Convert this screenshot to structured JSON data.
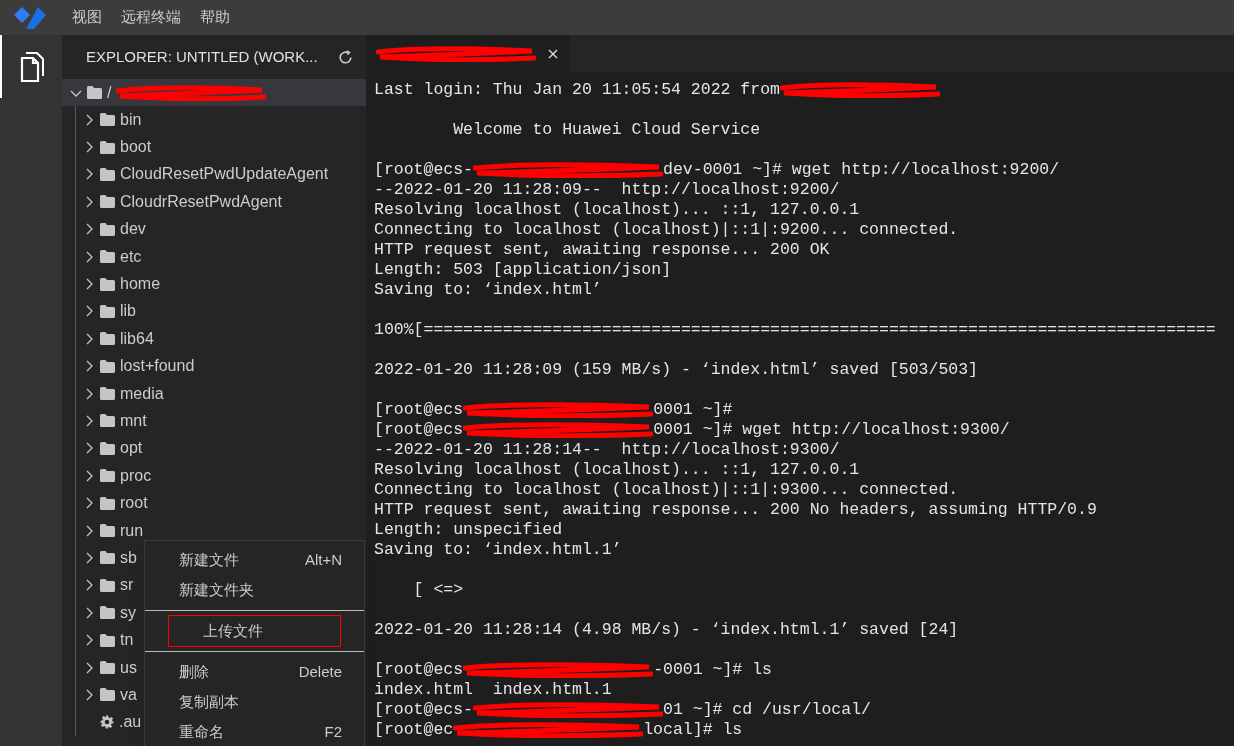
{
  "menu_bar": [
    "视图",
    "远程终端",
    "帮助"
  ],
  "explorer": {
    "title": "EXPLORER: UNTITLED (WORK...",
    "root": {
      "name": "/",
      "expanded": true,
      "selected": true,
      "redacted": true
    },
    "items": [
      {
        "name": "bin",
        "kind": "folder"
      },
      {
        "name": "boot",
        "kind": "folder"
      },
      {
        "name": "CloudResetPwdUpdateAgent",
        "kind": "folder"
      },
      {
        "name": "CloudrResetPwdAgent",
        "kind": "folder"
      },
      {
        "name": "dev",
        "kind": "folder"
      },
      {
        "name": "etc",
        "kind": "folder"
      },
      {
        "name": "home",
        "kind": "folder"
      },
      {
        "name": "lib",
        "kind": "folder"
      },
      {
        "name": "lib64",
        "kind": "folder"
      },
      {
        "name": "lost+found",
        "kind": "folder"
      },
      {
        "name": "media",
        "kind": "folder"
      },
      {
        "name": "mnt",
        "kind": "folder"
      },
      {
        "name": "opt",
        "kind": "folder"
      },
      {
        "name": "proc",
        "kind": "folder"
      },
      {
        "name": "root",
        "kind": "folder"
      },
      {
        "name": "run",
        "kind": "folder"
      },
      {
        "name": "sb",
        "kind": "folder"
      },
      {
        "name": "sr",
        "kind": "folder"
      },
      {
        "name": "sy",
        "kind": "folder"
      },
      {
        "name": "tn",
        "kind": "folder"
      },
      {
        "name": "us",
        "kind": "folder"
      },
      {
        "name": "va",
        "kind": "folder"
      },
      {
        "name": ".au",
        "kind": "settings"
      }
    ]
  },
  "context_menu": [
    {
      "label": "新建文件",
      "shortcut": "Alt+N",
      "marked": false
    },
    {
      "label": "新建文件夹",
      "marked": false,
      "separator_after": true
    },
    {
      "label": "上传文件",
      "marked": true,
      "separator_after": true
    },
    {
      "label": "删除",
      "shortcut": "Delete",
      "marked": false
    },
    {
      "label": "复制副本",
      "marked": false
    },
    {
      "label": "重命名",
      "shortcut": "F2",
      "marked": false
    }
  ],
  "terminal_tab": {
    "redacted": true
  },
  "terminal": [
    {
      "parts": [
        "Last login: Thu Jan 20 11:05:54 2022 from"
      ],
      "redacted_end": true
    },
    {
      "parts": [
        "        Welcome to Huawei Cloud Service"
      ],
      "space_before": true
    },
    {
      "parts": [
        "[root@ecs-",
        "dev-0001 ~]# wget http://localhost:9200/"
      ],
      "space_before": true
    },
    {
      "parts": [
        "--2022-01-20 11:28:09--  http://localhost:9200/"
      ]
    },
    {
      "parts": [
        "Resolving localhost (localhost)... ::1, 127.0.0.1"
      ]
    },
    {
      "parts": [
        "Connecting to localhost (localhost)|::1|:9200... connected."
      ]
    },
    {
      "parts": [
        "HTTP request sent, awaiting response... 200 OK"
      ]
    },
    {
      "parts": [
        "Length: 503 [application/json]"
      ]
    },
    {
      "parts": [
        "Saving to: ‘index.html’"
      ]
    },
    {
      "parts": [
        "100%[================================================================================"
      ],
      "space_before": true
    },
    {
      "parts": [
        "2022-01-20 11:28:09 (159 MB/s) - ‘index.html’ saved [503/503]"
      ],
      "space_before": true
    },
    {
      "parts": [
        "[root@ecs",
        "0001 ~]#"
      ],
      "space_before": true
    },
    {
      "parts": [
        "[root@ecs",
        "0001 ~]# wget http://localhost:9300/"
      ]
    },
    {
      "parts": [
        "--2022-01-20 11:28:14--  http://localhost:9300/"
      ]
    },
    {
      "parts": [
        "Resolving localhost (localhost)... ::1, 127.0.0.1"
      ]
    },
    {
      "parts": [
        "Connecting to localhost (localhost)|::1|:9300... connected."
      ]
    },
    {
      "parts": [
        "HTTP request sent, awaiting response... 200 No headers, assuming HTTP/0.9"
      ]
    },
    {
      "parts": [
        "Length: unspecified"
      ]
    },
    {
      "parts": [
        "Saving to: ‘index.html.1’"
      ]
    },
    {
      "parts": [
        "    [ <=>"
      ],
      "space_before": true
    },
    {
      "parts": [
        "2022-01-20 11:28:14 (4.98 MB/s) - ‘index.html.1’ saved [24]"
      ],
      "space_before": true
    },
    {
      "parts": [
        "[root@ecs",
        "-0001 ~]# ls"
      ],
      "space_before": true
    },
    {
      "parts": [
        "index.html  index.html.1"
      ]
    },
    {
      "parts": [
        "[root@ecs-",
        "01 ~]# cd /usr/local/"
      ]
    },
    {
      "parts": [
        "[root@ec",
        "local]# ls"
      ]
    }
  ]
}
